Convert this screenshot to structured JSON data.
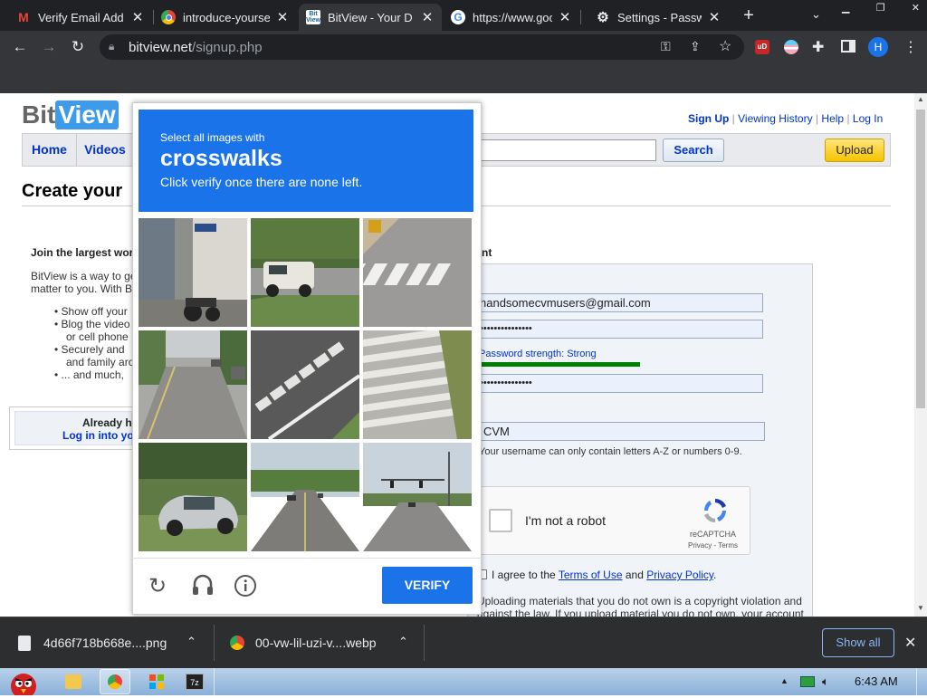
{
  "browser": {
    "tabs": [
      {
        "title": "Verify Email Add",
        "icon": "gmail-icon",
        "active": false
      },
      {
        "title": "introduce-yoursel",
        "icon": "chrome-icon",
        "active": false
      },
      {
        "title": "BitView - Your D",
        "icon": "bitview-icon",
        "active": true
      },
      {
        "title": "https://www.goo",
        "icon": "google-icon",
        "active": false
      },
      {
        "title": "Settings - Passw",
        "icon": "gear-icon",
        "active": false
      }
    ],
    "new_tab": "+",
    "url_host": "bitview.net",
    "url_path": "/signup.php",
    "profile_initial": "H"
  },
  "site": {
    "logo_bit": "Bit",
    "logo_view": "View",
    "top_links": [
      "Sign Up",
      "Viewing History",
      "Help",
      "Log In"
    ],
    "nav": [
      "Home",
      "Videos"
    ],
    "search_button": "Search",
    "upload_button": "Upload",
    "page_title": "Create your",
    "join_heading": "Join the largest wor",
    "intro_line1": "BitView is a way to ge",
    "intro_line2": "matter to you. With B",
    "bullets": [
      "Show off your",
      "Blog the video",
      "or cell phone",
      "Securely and",
      "and family aro",
      "... and much,"
    ],
    "already_text": "Already h",
    "login_link": "Log in into yo",
    "right_heading_tail": "nt",
    "form": {
      "email": "handsomecvmusers@gmail.com",
      "password_mask": "•••••••••••••••",
      "strength_label": "Password strength: Strong",
      "confirm_mask": "•••••••••••••••",
      "username": "CVM",
      "username_hint": "Your username can only contain letters A-Z or numbers 0-9.",
      "agree_pre": "I agree to the",
      "terms": "Terms of Use",
      "and": "and",
      "privacy": "Privacy Policy",
      "period": ".",
      "warning1": "Uploading materials that you do not own is a copyright violation and",
      "warning2": "against the law. If you upload material you do not own, your account"
    },
    "recaptcha": {
      "label": "I'm not a robot",
      "brand": "reCAPTCHA",
      "privacy": "Privacy",
      "dash": " - ",
      "terms": "Terms"
    }
  },
  "captcha": {
    "instruction": "Select all images with",
    "target": "crosswalks",
    "sub": "Click verify once there are none left.",
    "verify_button": "VERIFY",
    "tiles": [
      "street-sign-motorcycle",
      "parked-suv",
      "road-crosswalk",
      "residential-road",
      "crosswalk-closeup",
      "crosswalk-stripes",
      "silver-car",
      "highway",
      "intersection"
    ]
  },
  "downloads": {
    "items": [
      "4d66f718b668e....png",
      "00-vw-lil-uzi-v....webp"
    ],
    "show_all": "Show all"
  },
  "taskbar": {
    "time": "6:43 AM"
  }
}
